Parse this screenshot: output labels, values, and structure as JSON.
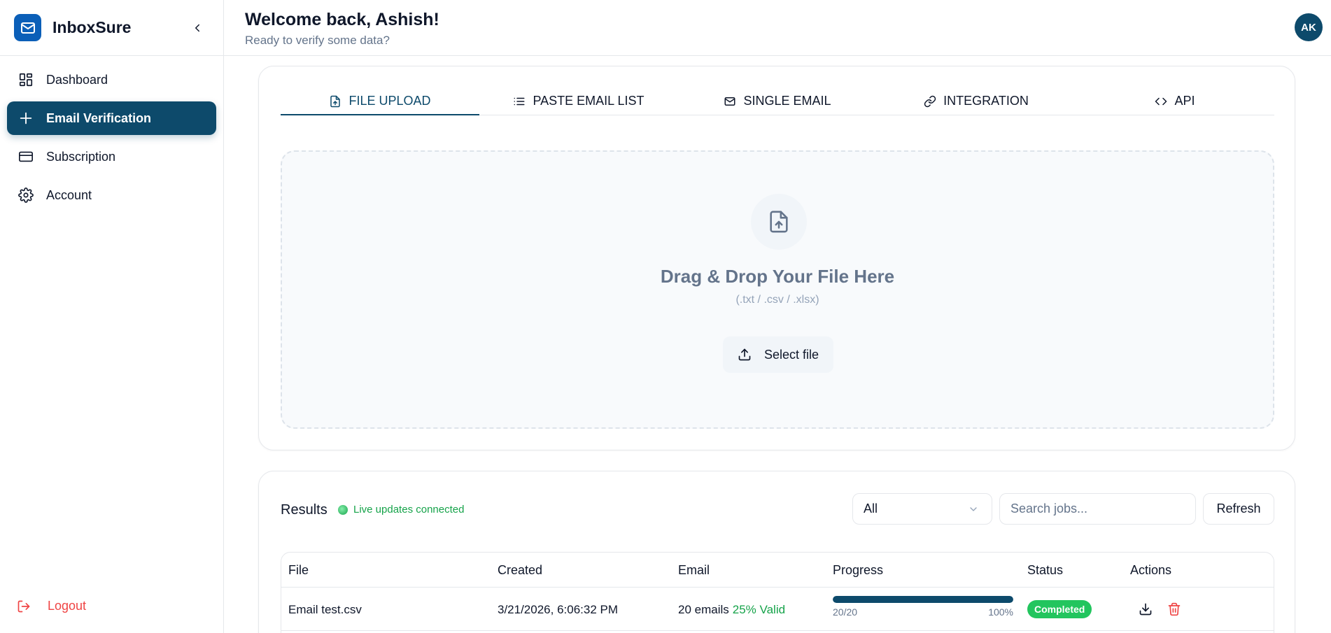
{
  "app": {
    "name": "InboxSure",
    "accent": "#0d4a6b",
    "logo_color": "#0b5fb8"
  },
  "sidebar": {
    "items": [
      {
        "label": "Dashboard",
        "icon": "dashboard-grid-icon",
        "active": false
      },
      {
        "label": "Email Verification",
        "icon": "plus-icon",
        "active": true
      },
      {
        "label": "Subscription",
        "icon": "credit-card-icon",
        "active": false
      },
      {
        "label": "Account",
        "icon": "gear-icon",
        "active": false
      }
    ],
    "logout_label": "Logout"
  },
  "header": {
    "title": "Welcome back, Ashish!",
    "subtitle": "Ready to verify some data?",
    "avatar_initials": "AK"
  },
  "upload": {
    "tabs": [
      {
        "label": "FILE UPLOAD",
        "icon": "file-upload-icon",
        "active": true
      },
      {
        "label": "PASTE EMAIL LIST",
        "icon": "list-icon",
        "active": false
      },
      {
        "label": "SINGLE EMAIL",
        "icon": "mail-icon",
        "active": false
      },
      {
        "label": "INTEGRATION",
        "icon": "link-icon",
        "active": false
      },
      {
        "label": "API",
        "icon": "code-icon",
        "active": false
      }
    ],
    "drop_title": "Drag & Drop Your File Here",
    "drop_hint": "(.txt / .csv / .xlsx)",
    "select_label": "Select file"
  },
  "results": {
    "title": "Results",
    "live_status": "Live updates connected",
    "filter_value": "All",
    "search_placeholder": "Search jobs...",
    "refresh_label": "Refresh",
    "columns": [
      "File",
      "Created",
      "Email",
      "Progress",
      "Status",
      "Actions"
    ],
    "rows": [
      {
        "file": "Email test.csv",
        "created": "3/21/2026, 6:06:32 PM",
        "emails": "20 emails",
        "valid": "25% Valid",
        "progress_count": "20/20",
        "progress_pct": "100%",
        "progress_value": 1.0,
        "status": "Completed",
        "status_color": "#22c55e"
      }
    ]
  }
}
